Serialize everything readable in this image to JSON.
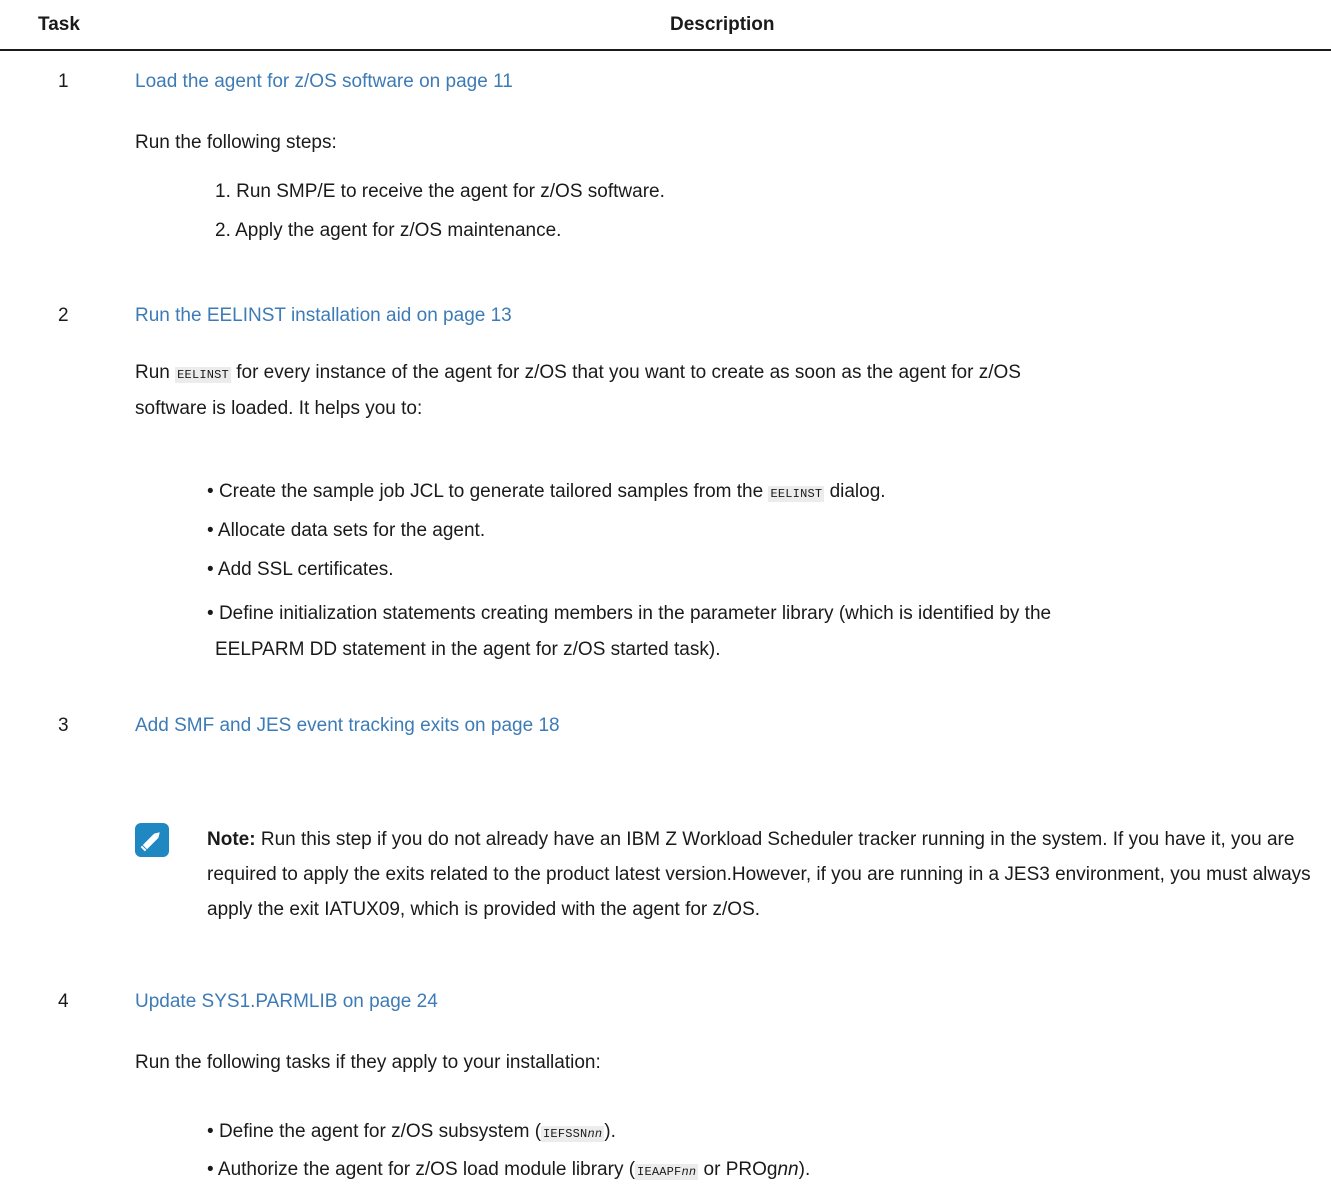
{
  "header": {
    "task": "Task",
    "description": "Description"
  },
  "rows": [
    {
      "number": "1",
      "link": "Load the agent for z/OS software on page 11",
      "intro": "Run the following steps:",
      "steps": [
        "1. Run SMP/E to receive the agent for z/OS software.",
        "2. Apply the agent for z/OS maintenance."
      ]
    },
    {
      "number": "2",
      "link": "Run the EELINST installation aid on page 13",
      "para_prefix": "Run",
      "para_code": "EELINST",
      "para_line1": "for every instance of the agent for z/OS that you want to create as soon as the agent for z/OS",
      "para_line2": "software is loaded. It helps you to:",
      "b1_pre": "Create the sample job JCL to generate tailored samples from the",
      "b1_code": "EELINST",
      "b1_post": "dialog.",
      "b2": "Allocate data sets for the agent.",
      "b3": "Add SSL certificates.",
      "b4_line1": "Define initialization statements creating members in the parameter library (which is identified by the",
      "b4_line2": "EELPARM DD statement in the agent for z/OS started task)."
    },
    {
      "number": "3",
      "link": "Add SMF and JES event tracking exits on page 18",
      "note_label": "Note:",
      "note_text": "Run this step if you do not already have an IBM Z Workload Scheduler tracker running in the system. If you have it, you are required to apply the exits related to the product latest version.However, if you are running in a JES3 environment, you must always apply the exit IATUX09, which is provided with the agent for z/OS."
    },
    {
      "number": "4",
      "link": "Update SYS1.PARMLIB on page 24",
      "intro": "Run the following tasks if they apply to your installation:",
      "b1_pre": "Define the agent for z/OS subsystem (",
      "b1_code": "IEFSSN",
      "b1_code_var": "nn",
      "b1_post": ").",
      "b2_pre": "Authorize the agent for z/OS load module library (",
      "b2_code": "IEAAPF",
      "b2_code_var": "nn",
      "b2_mid": " or PROg",
      "b2_var": "nn",
      "b2_post": ")."
    }
  ],
  "bullet_glyph": "•",
  "colors": {
    "link": "#3d7bb6",
    "note_icon": "#1f87c2",
    "code_bg": "#ececec"
  },
  "icons": {
    "note": "pencil-icon"
  }
}
